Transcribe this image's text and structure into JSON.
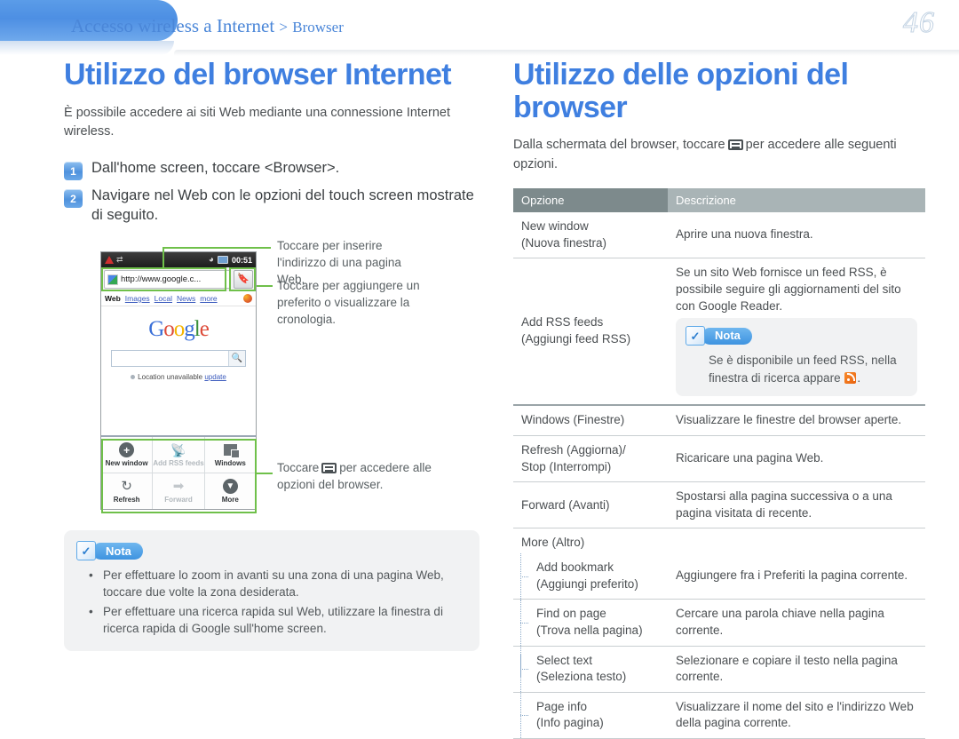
{
  "header": {
    "breadcrumb_main": "Accesso wireless a Internet",
    "breadcrumb_sep": ">",
    "breadcrumb_sub": "Browser",
    "page_number": "46"
  },
  "left": {
    "title": "Utilizzo del browser Internet",
    "intro": "È possibile accedere ai siti Web mediante una connessione Internet wireless.",
    "steps": [
      {
        "num": "1",
        "text": "Dall'home screen, toccare <Browser>."
      },
      {
        "num": "2",
        "text": "Navigare nel Web con le opzioni del touch screen mostrate di seguito."
      }
    ],
    "phone": {
      "status": {
        "time": "00:51"
      },
      "url": "http://www.google.c...",
      "gnav": {
        "web": "Web",
        "images": "Images",
        "local": "Local",
        "news": "News",
        "more": "more "
      },
      "logo": {
        "g1": "G",
        "o1": "o",
        "o2": "o",
        "g2": "g",
        "l": "l",
        "e": "e"
      },
      "location": "Location unavailable",
      "location_link": "update",
      "options": [
        {
          "label": "New window",
          "icon": "plus-circle-icon",
          "dim": false
        },
        {
          "label": "Add RSS feeds",
          "icon": "rss-icon",
          "dim": true
        },
        {
          "label": "Windows",
          "icon": "windows-icon",
          "dim": false
        },
        {
          "label": "Refresh",
          "icon": "refresh-icon",
          "dim": false
        },
        {
          "label": "Forward",
          "icon": "arrow-right-icon",
          "dim": true
        },
        {
          "label": "More",
          "icon": "chevron-down-circle-icon",
          "dim": true
        }
      ]
    },
    "callouts": [
      {
        "text": "Toccare per inserire l'indirizzo di una pagina Web."
      },
      {
        "text": "Toccare per aggiungere un preferito o visualizzare la cronologia."
      }
    ],
    "callout_menu": {
      "before": "Toccare",
      "icon": "menu-key-icon",
      "after": "per accedere alle opzioni del browser."
    },
    "nota": {
      "label": "Nota",
      "items": [
        "Per effettuare lo zoom in avanti su una zona di una pagina Web, toccare due volte la zona desiderata.",
        "Per effettuare una ricerca rapida sul Web, utilizzare la finestra di ricerca rapida di Google sull'home screen."
      ]
    }
  },
  "right": {
    "title": "Utilizzo delle opzioni del browser",
    "intro_before": "Dalla schermata del browser, toccare",
    "intro_icon": "menu-key-icon",
    "intro_after": "per accedere alle seguenti opzioni.",
    "table": {
      "headers": {
        "option": "Opzione",
        "description": "Descrizione"
      },
      "rows": [
        {
          "option": "New window\n(Nuova finestra)",
          "option_line1": "New window",
          "option_line2": "(Nuova finestra)",
          "description": "Aprire una nuova finestra."
        },
        {
          "option_line1": "Add RSS feeds",
          "option_line2": "(Aggiungi feed RSS)",
          "description": "Se un sito Web fornisce un feed RSS, è possibile seguire gli aggiornamenti del sito con Google Reader.",
          "nota": {
            "label": "Nota",
            "text_before": "Se è disponibile un feed RSS, nella finestra di ricerca appare",
            "icon": "rss-icon",
            "text_after": "."
          }
        },
        {
          "option_line1": "Windows (Finestre)",
          "option_line2": "",
          "description": "Visualizzare le finestre del browser aperte."
        },
        {
          "option_line1": "Refresh (Aggiorna)/",
          "option_line2": "Stop (Interrompi)",
          "description": "Ricaricare una pagina Web."
        },
        {
          "option_line1": "Forward (Avanti)",
          "option_line2": "",
          "description": "Spostarsi alla pagina successiva o a una pagina visitata di recente."
        },
        {
          "option_line1": "More (Altro)",
          "option_line2": "",
          "description": ""
        }
      ],
      "subrows": [
        {
          "option_line1": "Add bookmark",
          "option_line2": "(Aggiungi preferito)",
          "description": "Aggiungere fra i Preferiti la pagina corrente."
        },
        {
          "option_line1": "Find on page",
          "option_line2": "(Trova nella pagina)",
          "description": "Cercare una parola chiave nella pagina corrente."
        },
        {
          "option_line1": "Select text",
          "option_line2": "(Seleziona testo)",
          "description": "Selezionare e copiare il testo nella pagina corrente."
        },
        {
          "option_line1": "Page info",
          "option_line2": "(Info pagina)",
          "description": "Visualizzare il nome del sito e l'indirizzo Web della pagina corrente."
        }
      ]
    }
  },
  "colors": {
    "heading_blue": "#3f7fe0",
    "link_blue": "#5e9ae0",
    "highlight_green": "#6fc04a",
    "table_header_dark": "#7d8a8c",
    "table_header_light": "#a9b4b6",
    "rss_orange": "#e8620e"
  }
}
